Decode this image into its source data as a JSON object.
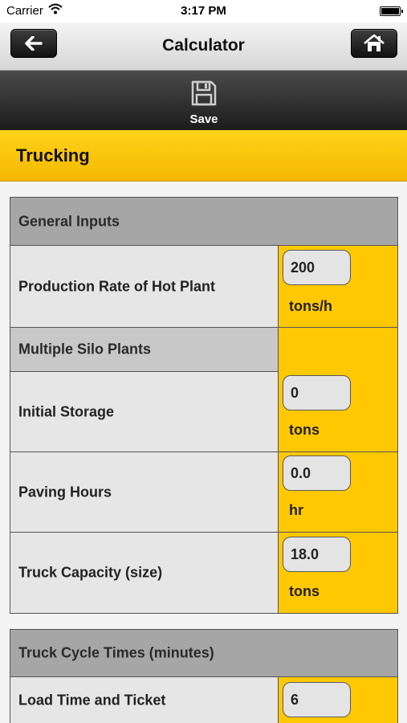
{
  "status_bar": {
    "carrier": "Carrier",
    "time": "3:17 PM"
  },
  "nav": {
    "title": "Calculator"
  },
  "toolbar": {
    "save_label": "Save"
  },
  "section": {
    "title": "Trucking"
  },
  "general_inputs": {
    "header": "General Inputs",
    "production_rate": {
      "label": "Production Rate of Hot Plant",
      "value": "200",
      "unit": "tons/h"
    },
    "multiple_silo_header": "Multiple Silo Plants",
    "initial_storage": {
      "label": "Initial Storage",
      "value": "0",
      "unit": "tons"
    },
    "paving_hours": {
      "label": "Paving Hours",
      "value": "0.0",
      "unit": "hr"
    },
    "truck_capacity": {
      "label": "Truck Capacity (size)",
      "value": "18.0",
      "unit": "tons"
    }
  },
  "truck_cycle": {
    "header": "Truck Cycle Times (minutes)",
    "load_time": {
      "label": "Load Time and Ticket",
      "value": "6"
    }
  },
  "colors": {
    "accent": "#ffc800",
    "header_gray": "#a6a6a6",
    "toolbar": "#2a2a2a"
  }
}
